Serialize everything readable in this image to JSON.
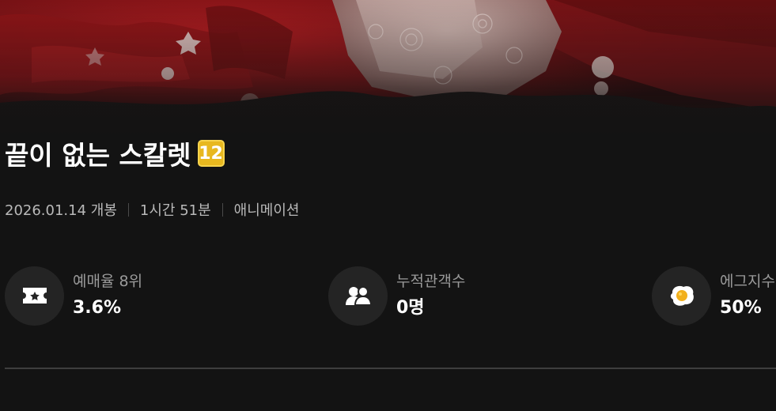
{
  "movie": {
    "title": "끝이 없는 스칼렛",
    "age_rating": "12"
  },
  "meta": {
    "release": "2026.01.14 개봉",
    "runtime": "1시간 51분",
    "genre": "애니메이션"
  },
  "stats": [
    {
      "icon": "ticket-icon",
      "label": "예매율 8위",
      "value": "3.6%"
    },
    {
      "icon": "audience-icon",
      "label": "누적관객수",
      "value": "0명"
    },
    {
      "icon": "egg-icon",
      "label": "에그지수",
      "value": "50%"
    }
  ],
  "colors": {
    "background": "#131313",
    "accent_badge": "#e8b81f",
    "hero_red": "#8a1518"
  }
}
